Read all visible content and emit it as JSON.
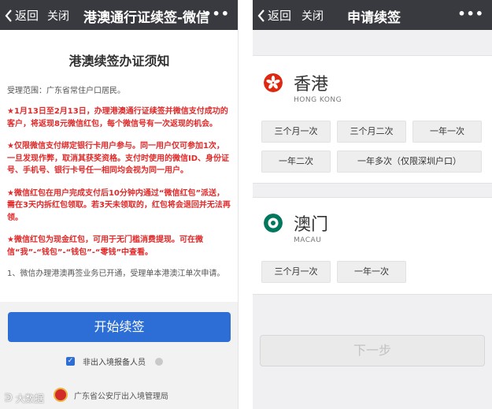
{
  "left": {
    "nav": {
      "back_label": "返回",
      "close_label": "关闭",
      "title": "港澳通行证续签-微信",
      "more_label": "•••"
    },
    "notice": {
      "title": "港澳续签办证须知",
      "scope": "受理范围：广东省常住户口居民。",
      "paragraphs": [
        "★1月13日至2月13日，办理港澳通行证续签并微信支付成功的客户，将返现8元微信红包，每个微信号有一次返现的机会。",
        "★仅限微信支付绑定银行卡用户参与。同一用户仅可参加1次，一旦发现作弊，取消其获奖资格。支付时使用的微信ID、身份证号、手机号、银行卡号任一相同均会视为同一用户。",
        "★微信红包在用户完成支付后10分钟内通过“微信红包”派送，需在3天内拆红包领取。若3天未领取的，红包将会退回并无法再领。",
        "★微信红包为现金红包，可用于无门槛消费提现。可在微信“我”-“钱包”-“钱包”-“零钱”中查看。"
      ],
      "trailing": "1、微信办理港澳再签业务已开通，受理单本港澳江单次申请。"
    },
    "start_button": "开始续签",
    "checkbox": {
      "checked_mark": "✓",
      "label": "非出入境报备人员"
    },
    "footer": "广东省公安厅出入境管理局",
    "watermark": "大数据"
  },
  "right": {
    "nav": {
      "back_label": "返回",
      "close_label": "关闭",
      "title": "申请续签",
      "more_label": "•••"
    },
    "regions": [
      {
        "name": "香港",
        "sub": "HONG KONG",
        "flag_color": "#de2910",
        "options": [
          "三个月一次",
          "三个月二次",
          "一年一次",
          "一年二次",
          "一年多次（仅限深圳户口）"
        ]
      },
      {
        "name": "澳门",
        "sub": "MACAU",
        "flag_color": "#00785e",
        "options": [
          "三个月一次",
          "一年一次"
        ]
      }
    ],
    "next_button": "下一步"
  },
  "colors": {
    "navbar": "#393a3f",
    "primary": "#2d6ed6",
    "notice_red": "#e02a2a"
  }
}
